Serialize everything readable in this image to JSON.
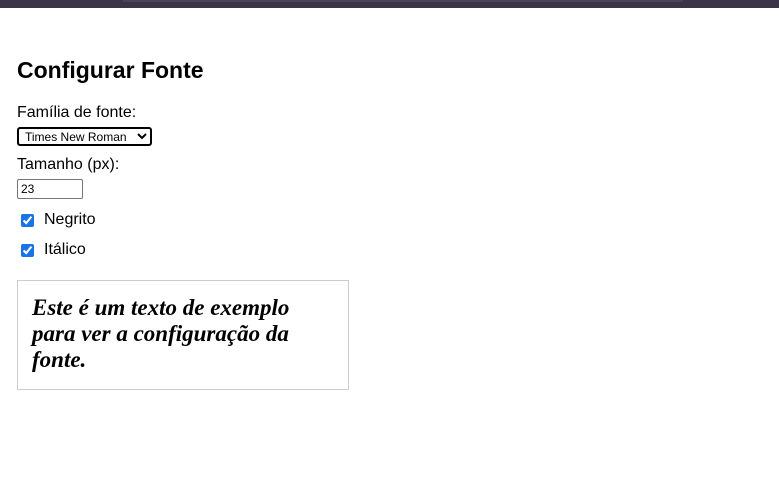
{
  "title": "Configurar Fonte",
  "font_family": {
    "label": "Família de fonte:",
    "selected": "Times New Roman"
  },
  "font_size": {
    "label": "Tamanho (px):",
    "value": "23"
  },
  "bold": {
    "label": "Negrito",
    "checked": true
  },
  "italic": {
    "label": "Itálico",
    "checked": true
  },
  "preview": {
    "text": "Este é um texto de exemplo para ver a configuração da fonte."
  },
  "colors": {
    "top_bar": "#3b3446",
    "checkbox_accent": "#1a73e8",
    "preview_border": "#cccccc"
  }
}
